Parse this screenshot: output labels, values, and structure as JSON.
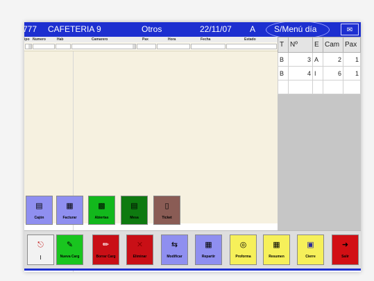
{
  "titlebar": {
    "code": "777",
    "location": "CAFETERIA 9",
    "section": "Otros",
    "date": "22/11/07",
    "status": "A",
    "menu": "S/Menú día"
  },
  "columns": {
    "tipo": "ipo",
    "numero": "Numero",
    "hab": "Hab",
    "camarero": "Camarero",
    "pax": "Pax",
    "hora": "Hora",
    "fecha": "Fecha",
    "estado": "Estado"
  },
  "right_table": {
    "headers": [
      "T",
      "Nº",
      "E",
      "Cam",
      "Pax"
    ],
    "rows": [
      {
        "t": "B",
        "n": "3",
        "e": "A",
        "cam": "2",
        "pax": "1"
      },
      {
        "t": "B",
        "n": "4",
        "e": "I",
        "cam": "6",
        "pax": "1"
      }
    ]
  },
  "action_buttons": [
    {
      "label": "Cajón",
      "icon": "cash-drawer-icon",
      "color": "#8f8ff0"
    },
    {
      "label": "Facturar",
      "icon": "invoice-icon",
      "color": "#8f8ff0"
    },
    {
      "label": "Abiertas",
      "icon": "open-tables-icon",
      "color": "#12b81c"
    },
    {
      "label": "Mesa",
      "icon": "table-icon",
      "color": "#0e7a10"
    },
    {
      "label": "Ticket",
      "icon": "ticket-icon",
      "color": "#8a5c55"
    }
  ],
  "bottom_buttons": [
    {
      "label": "I",
      "icon": "lock-icon",
      "color": "#f2f2f2"
    },
    {
      "label": "Nueva Carg",
      "icon": "pencil-icon",
      "color": "#19c51f"
    },
    {
      "label": "Borrar Carg",
      "icon": "eraser-icon",
      "color": "#c90f16"
    },
    {
      "label": "Eliminar",
      "icon": "delete-x-icon",
      "color": "#c90f16"
    },
    {
      "label": "Modificar",
      "icon": "modify-icon",
      "color": "#8f8ff0"
    },
    {
      "label": "Repartir",
      "icon": "split-icon",
      "color": "#8f8ff0"
    },
    {
      "label": "Proforma",
      "icon": "proforma-icon",
      "color": "#f6f05a"
    },
    {
      "label": "Resumen",
      "icon": "summary-icon",
      "color": "#f6f05a"
    },
    {
      "label": "Cierre",
      "icon": "close-register-icon",
      "color": "#f6f05a"
    },
    {
      "label": "Salir",
      "icon": "exit-icon",
      "color": "#d20f14"
    }
  ],
  "colors": {
    "titlebar": "#1d2fd0",
    "list_background": "#f6f1e0",
    "panel_background": "#c6c6c6"
  }
}
